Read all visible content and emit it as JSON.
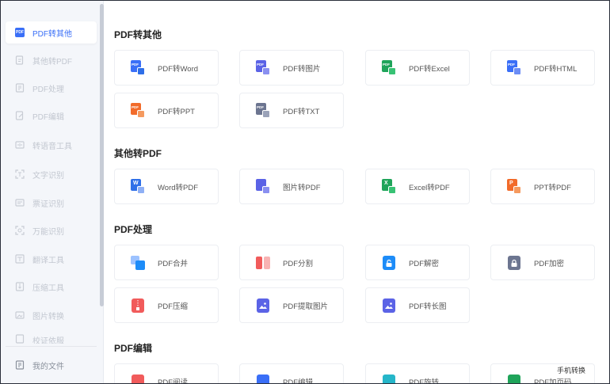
{
  "sidebar": {
    "items": [
      {
        "label": "PDF转其他",
        "icon": "pdf-icon"
      },
      {
        "label": "其他转PDF",
        "icon": "convert-icon"
      },
      {
        "label": "PDF处理",
        "icon": "process-icon"
      },
      {
        "label": "PDF编辑",
        "icon": "edit-icon"
      },
      {
        "label": "转语音工具",
        "icon": "voice-icon"
      },
      {
        "label": "文字识别",
        "icon": "text-recognition-icon"
      },
      {
        "label": "票证识别",
        "icon": "ticket-icon"
      },
      {
        "label": "万能识别",
        "icon": "universal-recognition-icon"
      },
      {
        "label": "翻译工具",
        "icon": "translate-icon"
      },
      {
        "label": "压缩工具",
        "icon": "compress-icon"
      },
      {
        "label": "图片转换",
        "icon": "image-convert-icon"
      },
      {
        "label": "校证依服",
        "icon": "partial-icon"
      }
    ],
    "active_icon_text": "PDF",
    "bottom": {
      "label": "我的文件",
      "icon": "file-icon"
    }
  },
  "sections": [
    {
      "title": "PDF转其他",
      "cards": [
        {
          "label": "PDF转Word",
          "icon": "pdf-to-word-icon"
        },
        {
          "label": "PDF转图片",
          "icon": "pdf-to-image-icon"
        },
        {
          "label": "PDF转Excel",
          "icon": "pdf-to-excel-icon"
        },
        {
          "label": "PDF转HTML",
          "icon": "pdf-to-html-icon"
        },
        {
          "label": "PDF转PPT",
          "icon": "pdf-to-ppt-icon"
        },
        {
          "label": "PDF转TXT",
          "icon": "pdf-to-txt-icon"
        }
      ]
    },
    {
      "title": "其他转PDF",
      "cards": [
        {
          "label": "Word转PDF",
          "icon": "word-to-pdf-icon"
        },
        {
          "label": "图片转PDF",
          "icon": "image-to-pdf-icon"
        },
        {
          "label": "Excel转PDF",
          "icon": "excel-to-pdf-icon"
        },
        {
          "label": "PPT转PDF",
          "icon": "ppt-to-pdf-icon"
        }
      ]
    },
    {
      "title": "PDF处理",
      "cards": [
        {
          "label": "PDF合并",
          "icon": "pdf-merge-icon"
        },
        {
          "label": "PDF分割",
          "icon": "pdf-split-icon"
        },
        {
          "label": "PDF解密",
          "icon": "pdf-decrypt-icon"
        },
        {
          "label": "PDF加密",
          "icon": "pdf-encrypt-icon"
        },
        {
          "label": "PDF压缩",
          "icon": "pdf-compress-icon"
        },
        {
          "label": "PDF提取图片",
          "icon": "pdf-extract-image-icon"
        },
        {
          "label": "PDF转长图",
          "icon": "pdf-to-long-image-icon"
        }
      ]
    },
    {
      "title": "PDF编辑",
      "cards": [
        {
          "label": "PDF阅读",
          "icon": "pdf-read-icon"
        },
        {
          "label": "PDF编辑",
          "icon": "pdf-edit-icon"
        },
        {
          "label": "PDF旋转",
          "icon": "pdf-rotate-icon"
        },
        {
          "label": "PDF加页码",
          "icon": "pdf-page-number-icon"
        }
      ]
    }
  ],
  "icon_text": {
    "pdf": "PDF",
    "word": "W",
    "excel": "X",
    "ppt": "P"
  },
  "mobile_convert": "手机转换",
  "colors": {
    "accent": "#3a6ff7",
    "pdf": "#3a6ff7",
    "word": "#2f6fe8",
    "excel": "#1fa45a",
    "ppt": "#f26b2a",
    "red": "#f15b5b",
    "purple": "#5b63e6"
  }
}
